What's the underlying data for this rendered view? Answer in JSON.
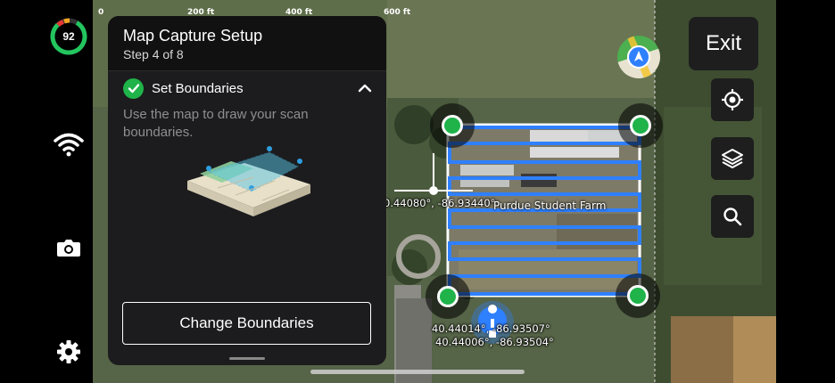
{
  "status": {
    "battery_percent": "92"
  },
  "scale": {
    "ticks": [
      "0",
      "200 ft",
      "400 ft",
      "600 ft"
    ]
  },
  "panel": {
    "title": "Map Capture Setup",
    "step": "Step 4 of 8",
    "section_label": "Set Boundaries",
    "description": "Use the map to draw your scan boundaries.",
    "change_button": "Change Boundaries"
  },
  "map": {
    "crosshair_coord": "0.44080°, -86.93440°",
    "farm_label": "Purdue Student Farm",
    "coord_1": "40.44014°, -86.93507°",
    "coord_2": "40.44006°, -86.93504°"
  },
  "controls": {
    "exit_label": "Exit"
  },
  "colors": {
    "accent_green": "#1fb34a",
    "boundary_blue": "#2f80ff",
    "panel_bg": "#1c1c1e"
  }
}
